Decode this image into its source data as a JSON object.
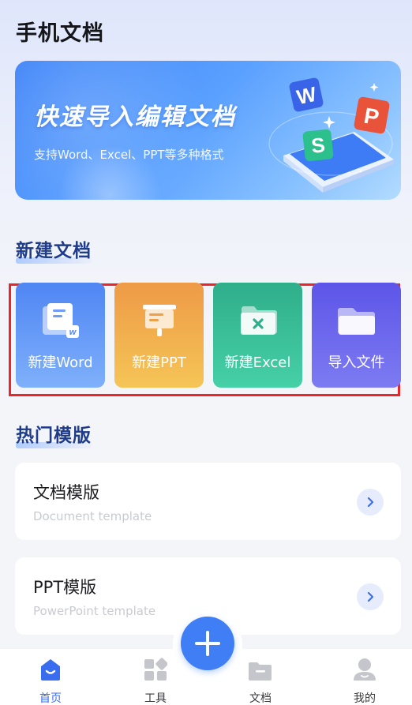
{
  "header": {
    "title": "手机文档"
  },
  "banner": {
    "title": "快速导入编辑文档",
    "subtitle": "支持Word、Excel、PPT等多种格式",
    "badges": [
      "W",
      "P",
      "S"
    ]
  },
  "new_section": {
    "title": "新建文档"
  },
  "actions": [
    {
      "label": "新建Word",
      "icon": "word-doc-icon",
      "color": "#4f86f3"
    },
    {
      "label": "新建PPT",
      "icon": "ppt-board-icon",
      "color": "#ee9a47"
    },
    {
      "label": "新建Excel",
      "icon": "excel-folder-icon",
      "color": "#2fae8a"
    },
    {
      "label": "导入文件",
      "icon": "folder-icon",
      "color": "#5d55e8"
    }
  ],
  "templates_section": {
    "title": "热门模版"
  },
  "templates": [
    {
      "title": "文档模版",
      "subtitle": "Document template"
    },
    {
      "title": "PPT模版",
      "subtitle": "PowerPoint template"
    }
  ],
  "tabbar": {
    "items": [
      {
        "label": "首页",
        "icon": "home-icon",
        "active": true
      },
      {
        "label": "工具",
        "icon": "grid-tools-icon",
        "active": false
      },
      {
        "label": "文档",
        "icon": "folder-icon",
        "active": false
      },
      {
        "label": "我的",
        "icon": "user-icon",
        "active": false
      }
    ]
  },
  "colors": {
    "accent": "#3f7ef5",
    "highlight_border": "#e8262b",
    "section_title": "#1f3c8a"
  }
}
